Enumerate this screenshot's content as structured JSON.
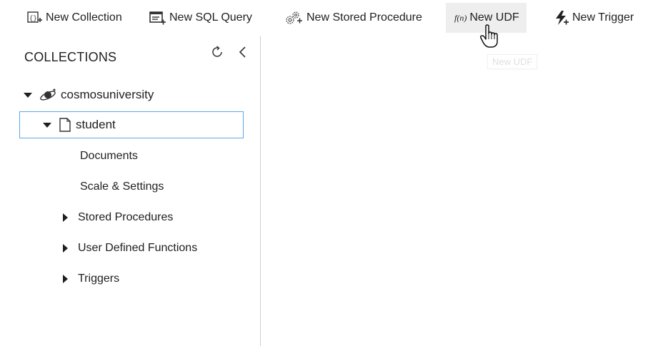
{
  "toolbar": {
    "new_collection": "New Collection",
    "new_sql_query": "New SQL Query",
    "new_stored_procedure": "New Stored Procedure",
    "new_udf": "New UDF",
    "udf_icon_text": "f(n)",
    "new_trigger": "New Trigger",
    "tooltip": "New UDF"
  },
  "sidebar": {
    "header": "COLLECTIONS",
    "database": "cosmosuniversity",
    "collection": "student",
    "items": [
      {
        "label": "Documents"
      },
      {
        "label": "Scale & Settings"
      },
      {
        "label": "Stored Procedures"
      },
      {
        "label": "User Defined Functions"
      },
      {
        "label": "Triggers"
      }
    ]
  },
  "colors": {
    "selection_border": "#5aa7e8",
    "hover_background": "#eeeeee",
    "divider": "#d0d0d0"
  },
  "icons": [
    "new-collection-icon",
    "new-sql-query-icon",
    "new-stored-procedure-icon",
    "new-udf-icon",
    "new-trigger-icon",
    "refresh-icon",
    "collapse-icon",
    "database-icon",
    "collection-icon",
    "hand-cursor-icon"
  ]
}
